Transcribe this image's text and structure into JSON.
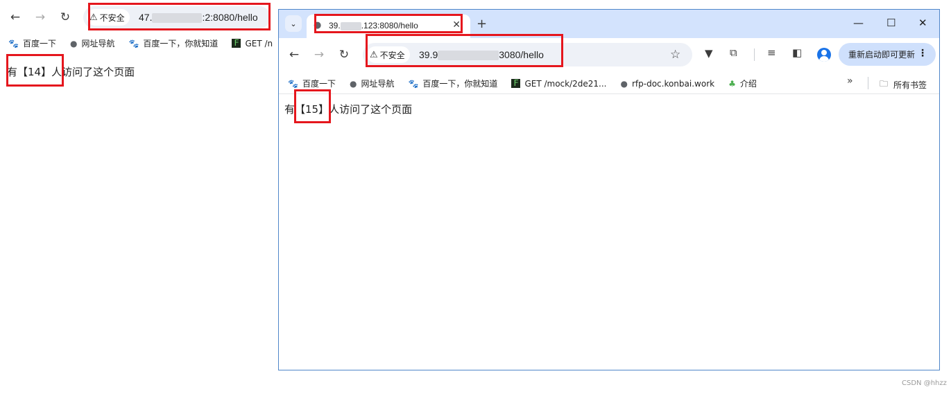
{
  "back_window": {
    "security_chip": "不安全",
    "url_prefix": "47.",
    "url_suffix": ":2:8080/hello",
    "bookmarks": [
      {
        "icon": "baidu-paw-icon",
        "label": "百度一下"
      },
      {
        "icon": "globe-icon",
        "label": "网址导航"
      },
      {
        "icon": "baidu-paw-icon",
        "label": "百度一下，你就知道"
      },
      {
        "icon": "terminal-icon",
        "label": "GET /n"
      }
    ],
    "page_text_before": "有",
    "page_count": "【14】",
    "page_text_after": "人访问了这个页面"
  },
  "front_window": {
    "tab_title_prefix": "39.",
    "tab_title_suffix": ".123:8080/hello",
    "security_chip": "不安全",
    "url_prefix": "39.9",
    "url_suffix": "3080/hello",
    "update_button": "重新启动即可更新",
    "bookmarks": [
      {
        "icon": "baidu-paw-icon",
        "label": "百度一下"
      },
      {
        "icon": "globe-icon",
        "label": "网址导航"
      },
      {
        "icon": "baidu-paw-icon",
        "label": "百度一下，你就知道"
      },
      {
        "icon": "terminal-icon",
        "label": "GET /mock/2de21..."
      },
      {
        "icon": "globe-icon",
        "label": "rfp-doc.konbai.work"
      },
      {
        "icon": "gourd-icon",
        "label": "介绍"
      }
    ],
    "all_bookmarks": "所有书签",
    "page_text_before": "有",
    "page_count": "【15】",
    "page_text_after": "人访问了这个页面"
  },
  "watermark": "CSDN @hhzz",
  "colors": {
    "highlight_box": "#e5161d",
    "tabstrip": "#d3e3fd",
    "update_button": "#cfe0fc"
  }
}
